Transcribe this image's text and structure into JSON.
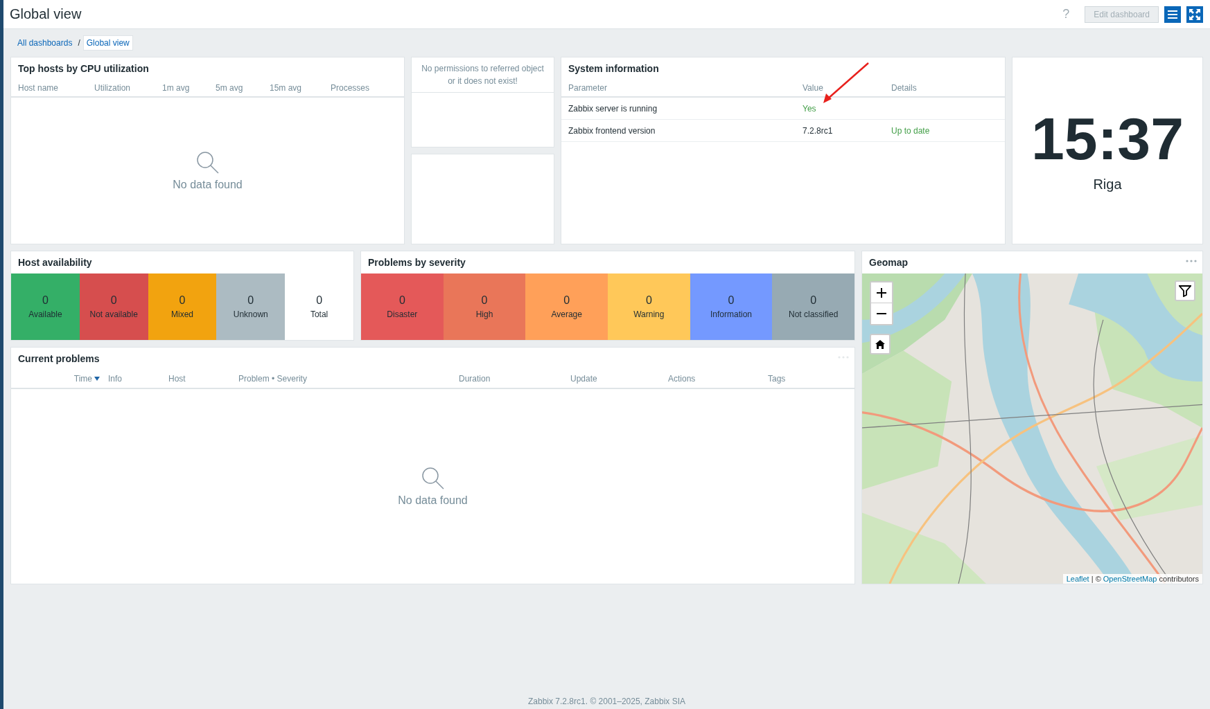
{
  "header": {
    "title": "Global view",
    "help": "?",
    "edit_button": {
      "label": "Edit dashboard",
      "disabled": true
    }
  },
  "breadcrumbs": [
    {
      "label": "All dashboards",
      "selected": false
    },
    {
      "label": "Global view",
      "selected": true
    }
  ],
  "breadcrumb_separator": "/",
  "top_hosts": {
    "title": "Top hosts by CPU utilization",
    "columns": [
      "Host name",
      "Utilization",
      "1m avg",
      "5m avg",
      "15m avg",
      "Processes"
    ],
    "empty": "No data found"
  },
  "no_permissions": {
    "message": "No permissions to referred object or it does not exist!"
  },
  "system_info": {
    "title": "System information",
    "columns": [
      "Parameter",
      "Value",
      "Details"
    ],
    "rows": [
      {
        "parameter": "Zabbix server is running",
        "value": "Yes",
        "value_ok": true
      },
      {
        "parameter": "Zabbix frontend version",
        "value": "7.2.8rc1",
        "value_ok": false,
        "details": "Up to date",
        "details_ok": true
      }
    ]
  },
  "clock": {
    "time": "15:37",
    "location": "Riga"
  },
  "host_availability": {
    "title": "Host availability",
    "items": [
      {
        "count": "0",
        "label": "Available",
        "color": "#34af67"
      },
      {
        "count": "0",
        "label": "Not available",
        "color": "#d64e4e"
      },
      {
        "count": "0",
        "label": "Mixed",
        "color": "#f2a30f"
      },
      {
        "count": "0",
        "label": "Unknown",
        "color": "#acbbc2"
      },
      {
        "count": "0",
        "label": "Total",
        "color": "#ffffff"
      }
    ]
  },
  "problems_by_severity": {
    "title": "Problems by severity",
    "items": [
      {
        "count": "0",
        "label": "Disaster",
        "color": "#e45959"
      },
      {
        "count": "0",
        "label": "High",
        "color": "#e97659"
      },
      {
        "count": "0",
        "label": "Average",
        "color": "#ffa059"
      },
      {
        "count": "0",
        "label": "Warning",
        "color": "#ffc859"
      },
      {
        "count": "0",
        "label": "Information",
        "color": "#7499ff"
      },
      {
        "count": "0",
        "label": "Not classified",
        "color": "#97aab3"
      }
    ]
  },
  "current_problems": {
    "title": "Current problems",
    "columns": [
      {
        "label": "Time",
        "sorted": true
      },
      {
        "label": "Info",
        "sorted": false
      },
      {
        "label": "Host",
        "sorted": false
      },
      {
        "label": "Problem • Severity",
        "sorted": false
      },
      {
        "label": "Duration",
        "sorted": false
      },
      {
        "label": "Update",
        "sorted": false
      },
      {
        "label": "Actions",
        "sorted": false
      },
      {
        "label": "Tags",
        "sorted": false
      }
    ],
    "empty": "No data found"
  },
  "geomap": {
    "title": "Geomap",
    "attribution": {
      "link": "Leaflet",
      "separator": " | © ",
      "source": "OpenStreetMap",
      "tail": " contributors"
    }
  },
  "footer": "Zabbix 7.2.8rc1. © 2001–2025, Zabbix SIA"
}
